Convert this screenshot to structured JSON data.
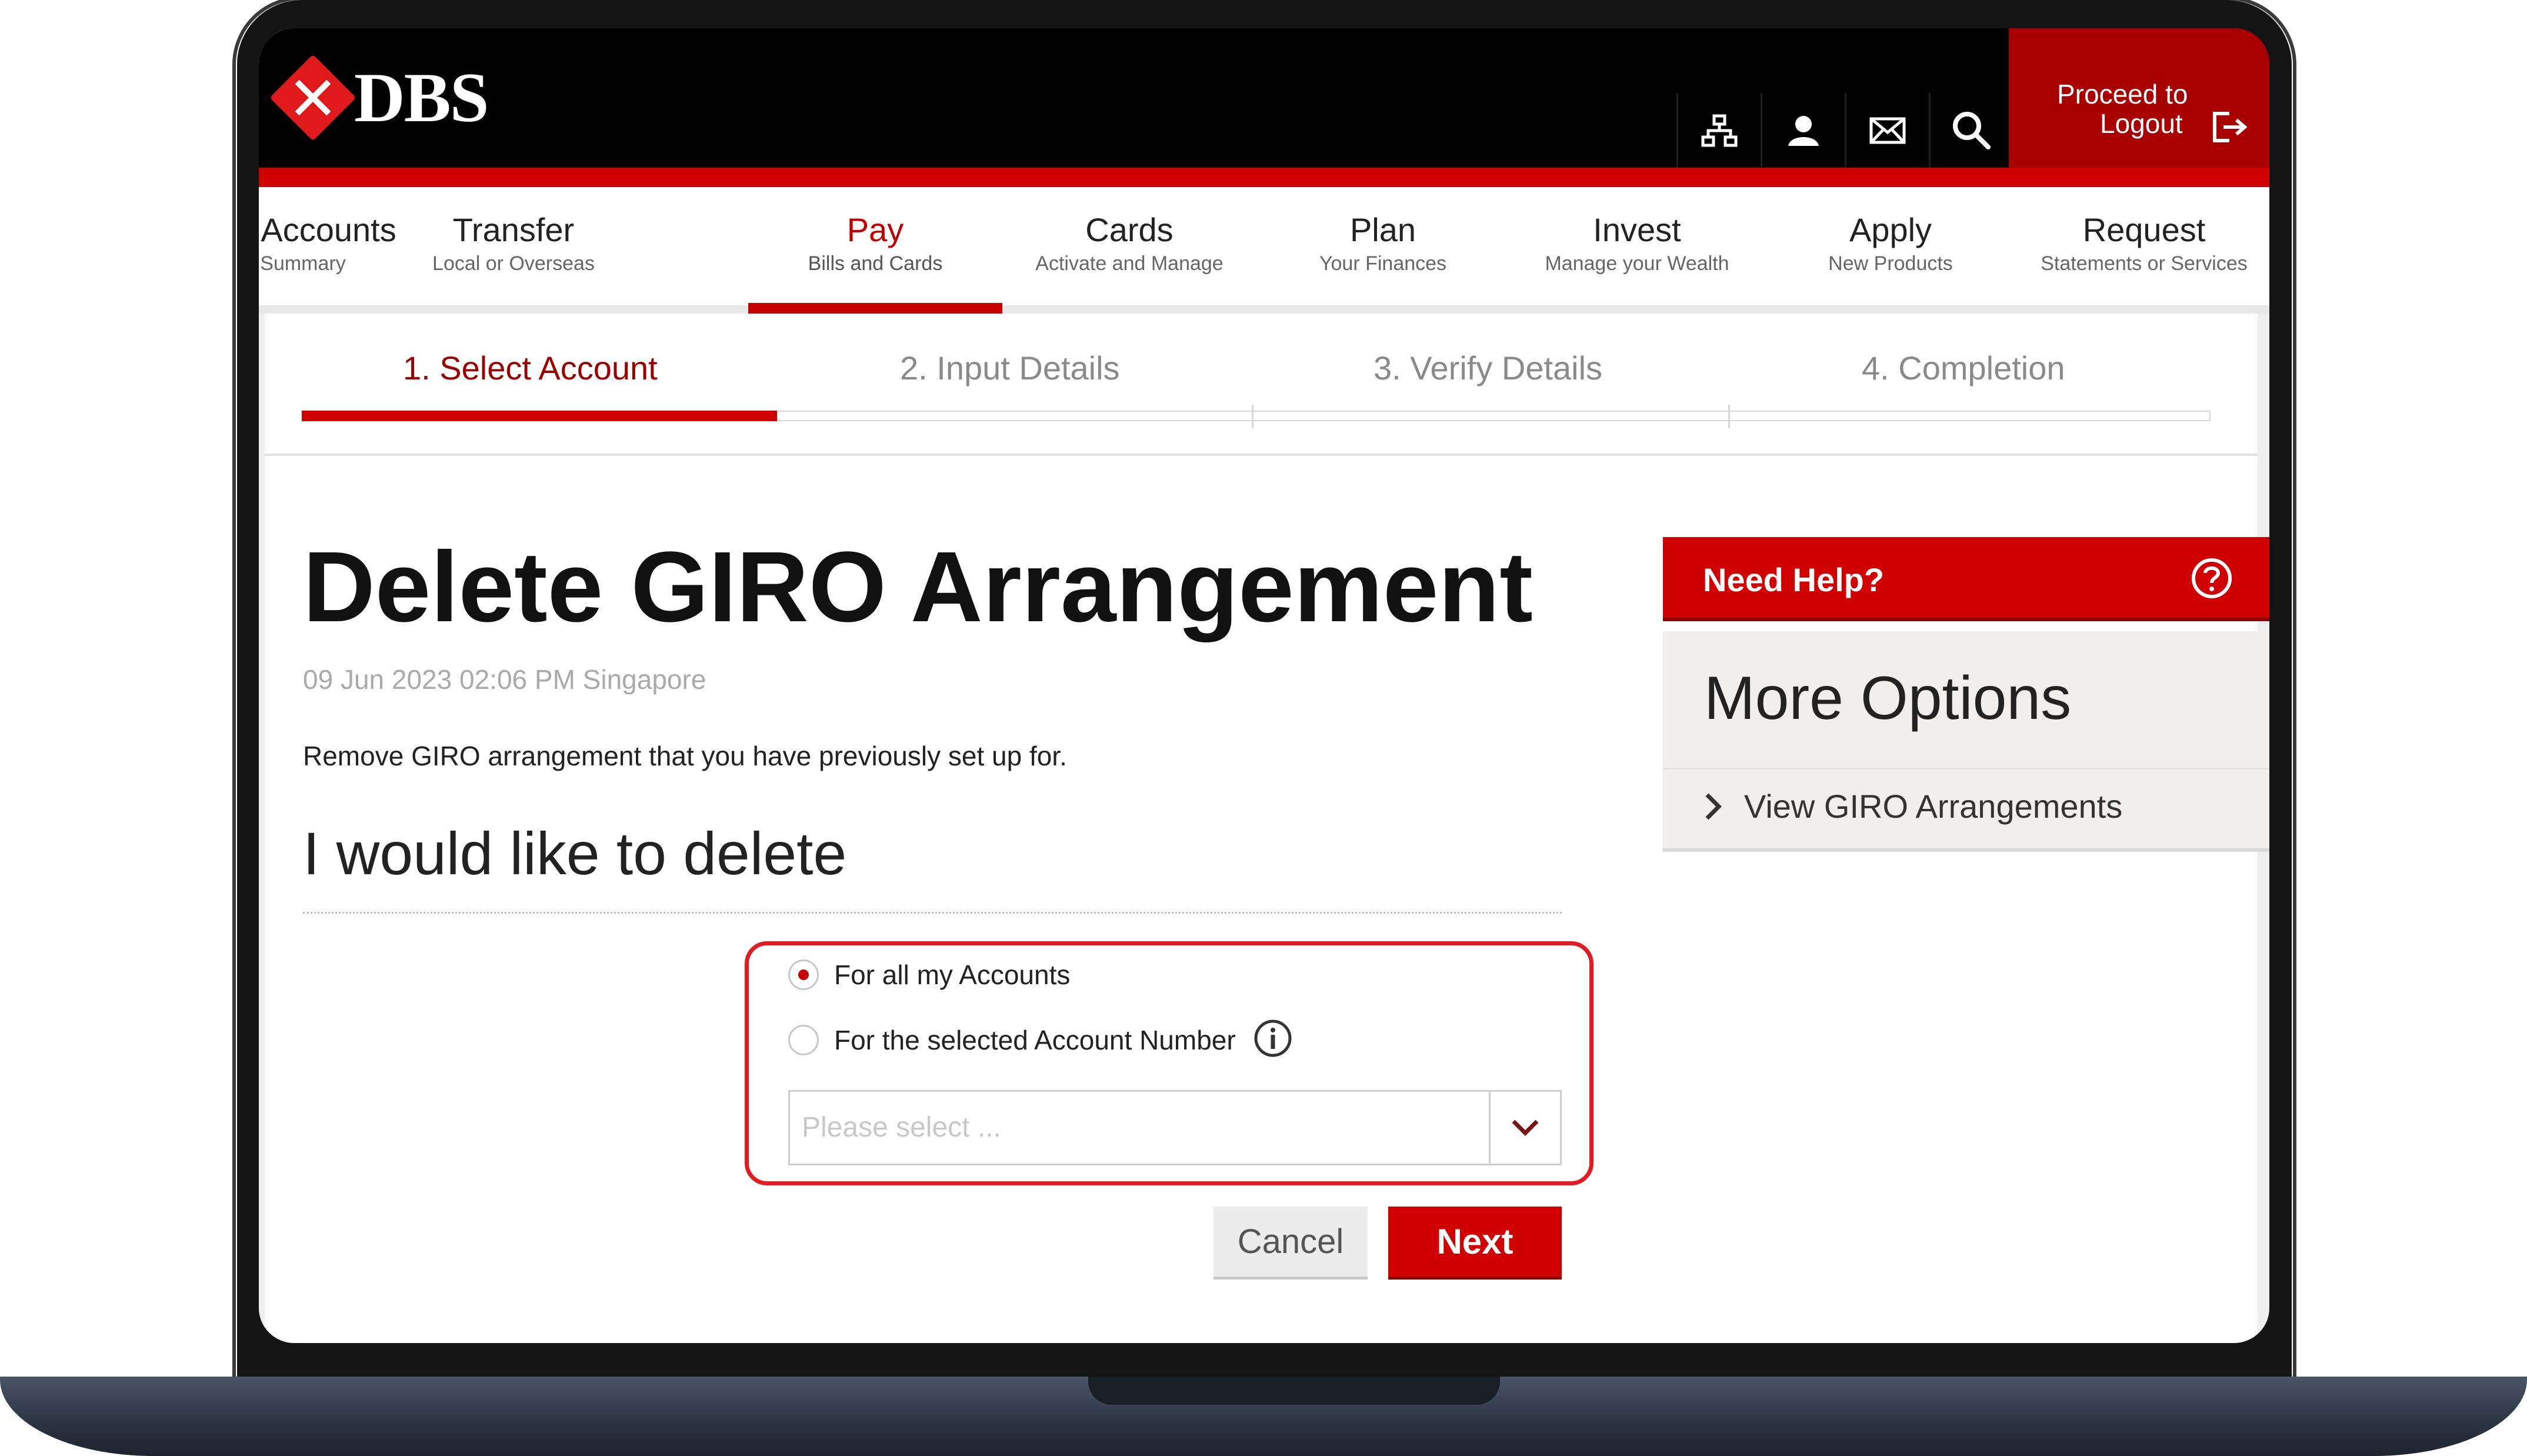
{
  "header": {
    "brand": "DBS",
    "logout_line1": "Proceed to",
    "logout_line2": "Logout",
    "icons": [
      "sitemap-icon",
      "profile-icon",
      "mail-icon",
      "search-icon",
      "logout-icon"
    ]
  },
  "nav": {
    "items": [
      {
        "title": "My Accounts",
        "sub": "Summary"
      },
      {
        "title": "Transfer",
        "sub": "Local or Overseas"
      },
      {
        "title": "Pay",
        "sub": "Bills and Cards"
      },
      {
        "title": "Cards",
        "sub": "Activate and Manage"
      },
      {
        "title": "Plan",
        "sub": "Your Finances"
      },
      {
        "title": "Invest",
        "sub": "Manage your Wealth"
      },
      {
        "title": "Apply",
        "sub": "New Products"
      },
      {
        "title": "Request",
        "sub": "Statements or Services"
      }
    ],
    "active": "Pay"
  },
  "steps": [
    {
      "label": "1. Select Account",
      "active": true
    },
    {
      "label": "2. Input Details",
      "active": false
    },
    {
      "label": "3. Verify Details",
      "active": false
    },
    {
      "label": "4. Completion",
      "active": false
    }
  ],
  "main": {
    "title": "Delete GIRO Arrangement",
    "timestamp": "09 Jun 2023 02:06 PM Singapore",
    "description": "Remove GIRO arrangement that you have previously set up for.",
    "subheading": "I would like to delete",
    "options": [
      {
        "label": "For all my Accounts",
        "selected": true
      },
      {
        "label": "For the selected Account Number",
        "selected": false
      }
    ],
    "account_select_placeholder": "Please select ...",
    "cancel_label": "Cancel",
    "next_label": "Next"
  },
  "sidebar": {
    "help_label": "Need Help?",
    "more_title": "More Options",
    "links": [
      "View GIRO Arrangements"
    ]
  },
  "colors": {
    "brand_red": "#d10000",
    "dark_red": "#9b0000",
    "header_black": "#000000",
    "highlight_border": "#e31b23"
  }
}
